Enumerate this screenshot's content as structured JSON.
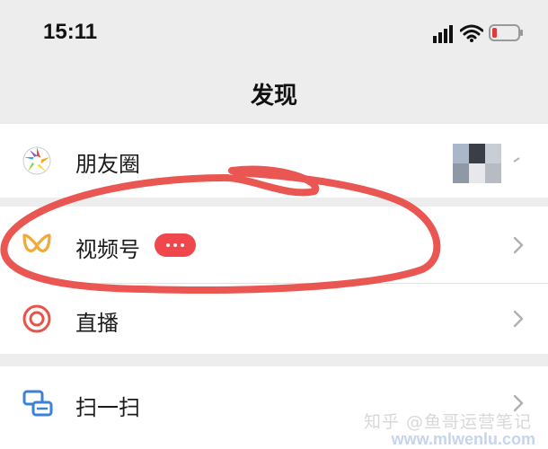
{
  "status_bar": {
    "time": "15:11",
    "icons": [
      "signal-icon",
      "wifi-icon",
      "battery-low-icon"
    ]
  },
  "header": {
    "title": "发现"
  },
  "menu": {
    "moments": {
      "label": "朋友圈",
      "icon": "moments-icon"
    },
    "channels": {
      "label": "视频号",
      "icon": "channels-icon",
      "badge": "···"
    },
    "live": {
      "label": "直播",
      "icon": "live-icon"
    },
    "scan": {
      "label": "扫一扫",
      "icon": "scan-icon"
    }
  },
  "watermark": {
    "text": "知乎 @鱼哥运营笔记",
    "url": "www.mlwenlu.com"
  },
  "colors": {
    "background": "#ededed",
    "row": "#ffffff",
    "badge": "#f0474c",
    "annotation": "#e8453f",
    "channels_icon": "#f2a93b",
    "live_icon": "#e8534a"
  }
}
